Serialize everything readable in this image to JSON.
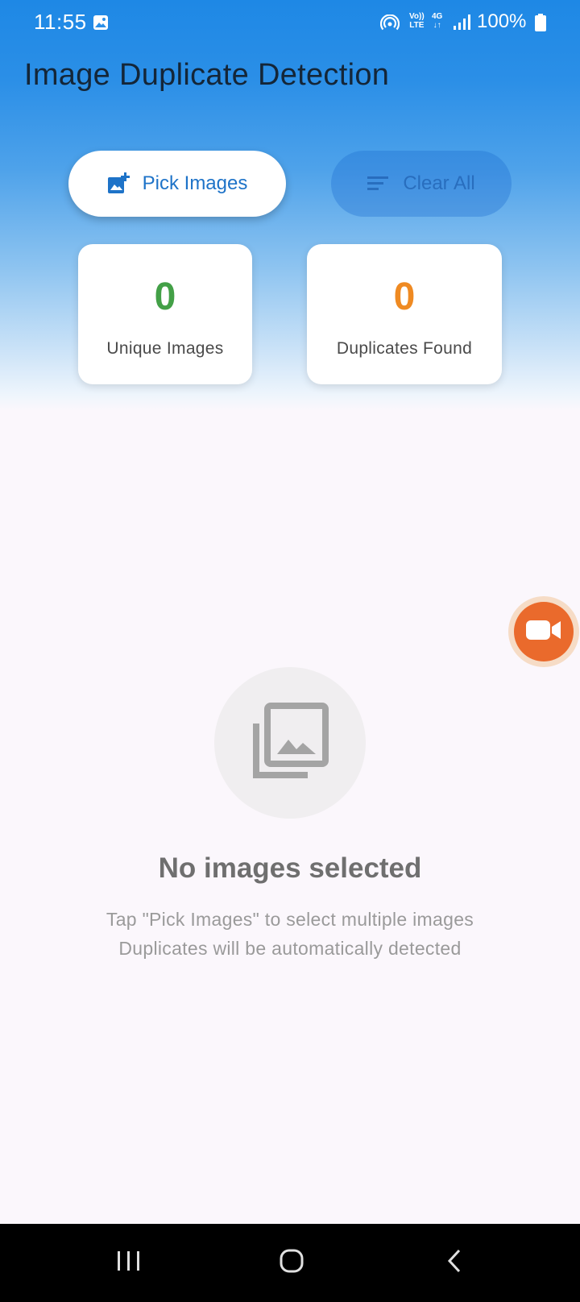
{
  "status_bar": {
    "time": "11:55",
    "volte_top": "Vo))",
    "volte_bottom": "LTE",
    "network_top": "4G",
    "network_bottom": "↓↑",
    "battery": "100%",
    "icons": [
      "gallery-icon",
      "hotspot-icon",
      "signal-icon",
      "battery-icon"
    ]
  },
  "app_bar": {
    "title": "Image Duplicate Detection"
  },
  "actions": {
    "pick_label": "Pick Images",
    "pick_icon": "add-photo-icon",
    "clear_label": "Clear All",
    "clear_icon": "clear-all-icon"
  },
  "stats": {
    "unique": {
      "value": "0",
      "label": "Unique Images",
      "color": "#43a047"
    },
    "duplicates": {
      "value": "0",
      "label": "Duplicates Found",
      "color": "#ef8a22"
    }
  },
  "empty_state": {
    "icon": "photo-library-icon",
    "title": "No images selected",
    "line1": "Tap \"Pick Images\" to select multiple images",
    "line2": "Duplicates will be automatically detected"
  },
  "floating_button": {
    "icon": "video-camera-icon",
    "color": "#ea6a2c"
  },
  "nav_bar": {
    "buttons": [
      "recents-icon",
      "home-icon",
      "back-icon"
    ]
  },
  "colors": {
    "primary": "#1e88e5",
    "background": "#fbf7fc"
  }
}
